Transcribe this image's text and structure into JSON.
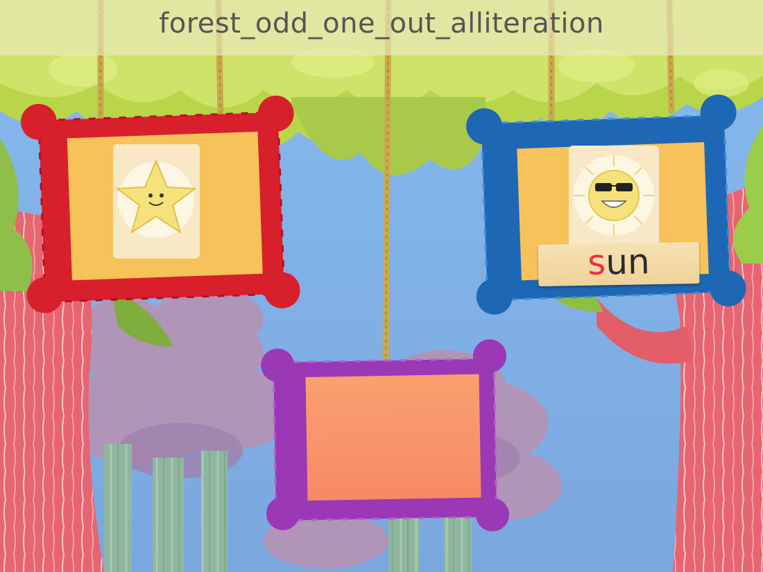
{
  "title": "forest_odd_one_out_alliteration",
  "colors": {
    "sky": "#7fb2e6",
    "title_bar": "#ecead0",
    "frame_red": "#d8202d",
    "frame_blue": "#1e67b5",
    "frame_purple": "#9a38b6",
    "card_yellow": "#f7c25a",
    "card_orange": "#f7926a",
    "letter_red": "#e8323f",
    "leaves": "#b9d64a",
    "trunk": "#e8606a"
  },
  "frames": [
    {
      "name": "left-frame",
      "color": "red",
      "picture": "star-icon",
      "word": ""
    },
    {
      "name": "right-frame",
      "color": "blue",
      "picture": "sun-icon",
      "word": "sun"
    },
    {
      "name": "bottom-frame",
      "color": "purple",
      "picture": "",
      "word": ""
    }
  ],
  "word_label": {
    "first_letter": "s",
    "rest": "un"
  }
}
